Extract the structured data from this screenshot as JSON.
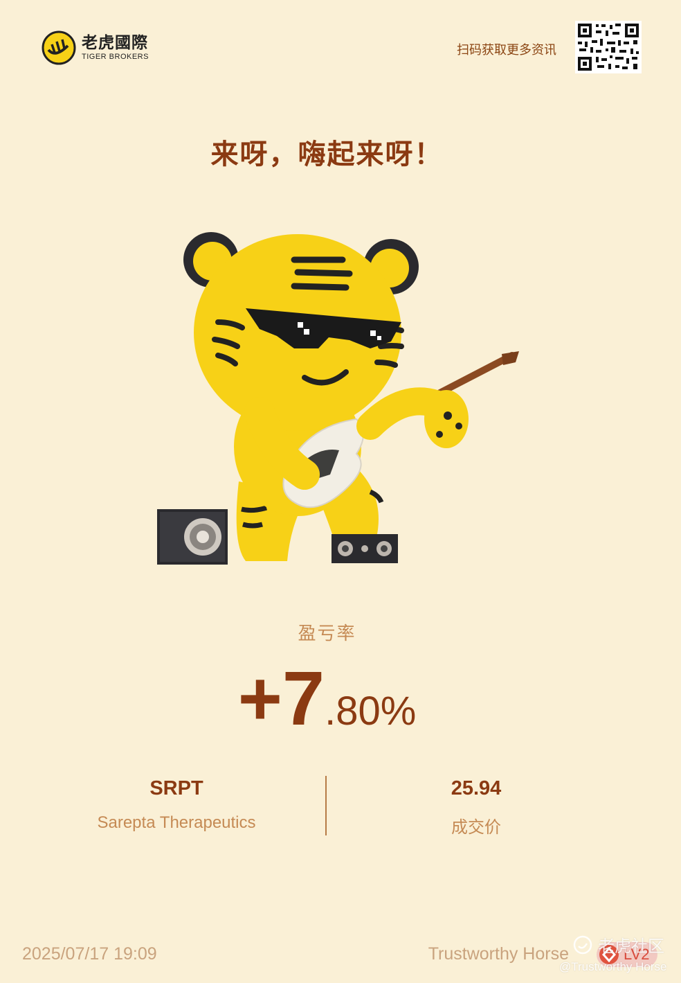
{
  "header": {
    "brand_cn": "老虎國際",
    "brand_en": "TIGER BROKERS",
    "scan_text": "扫码获取更多资讯",
    "logo_icon": "tiger-logo-icon",
    "qr_icon": "qr-code"
  },
  "headline": "来呀，嗨起来呀！",
  "mascot_icon": "tiger-guitar-mascot",
  "profit": {
    "label": "盈亏率",
    "integer": "+7",
    "decimal": ".80%"
  },
  "stock": {
    "ticker": "SRPT",
    "company": "Sarepta Therapeutics",
    "price": "25.94",
    "price_label": "成交价"
  },
  "footer": {
    "datetime": "2025/07/17 19:09",
    "username": "Trustworthy Horse",
    "level": "LV2"
  },
  "watermark": {
    "name": "老虎社区",
    "handle": "@Trustworthy Horse"
  },
  "colors": {
    "background": "#FAF0D6",
    "primary_brown": "#8B3A12",
    "secondary_tan": "#C58A54",
    "tiger_yellow": "#F7D117"
  }
}
